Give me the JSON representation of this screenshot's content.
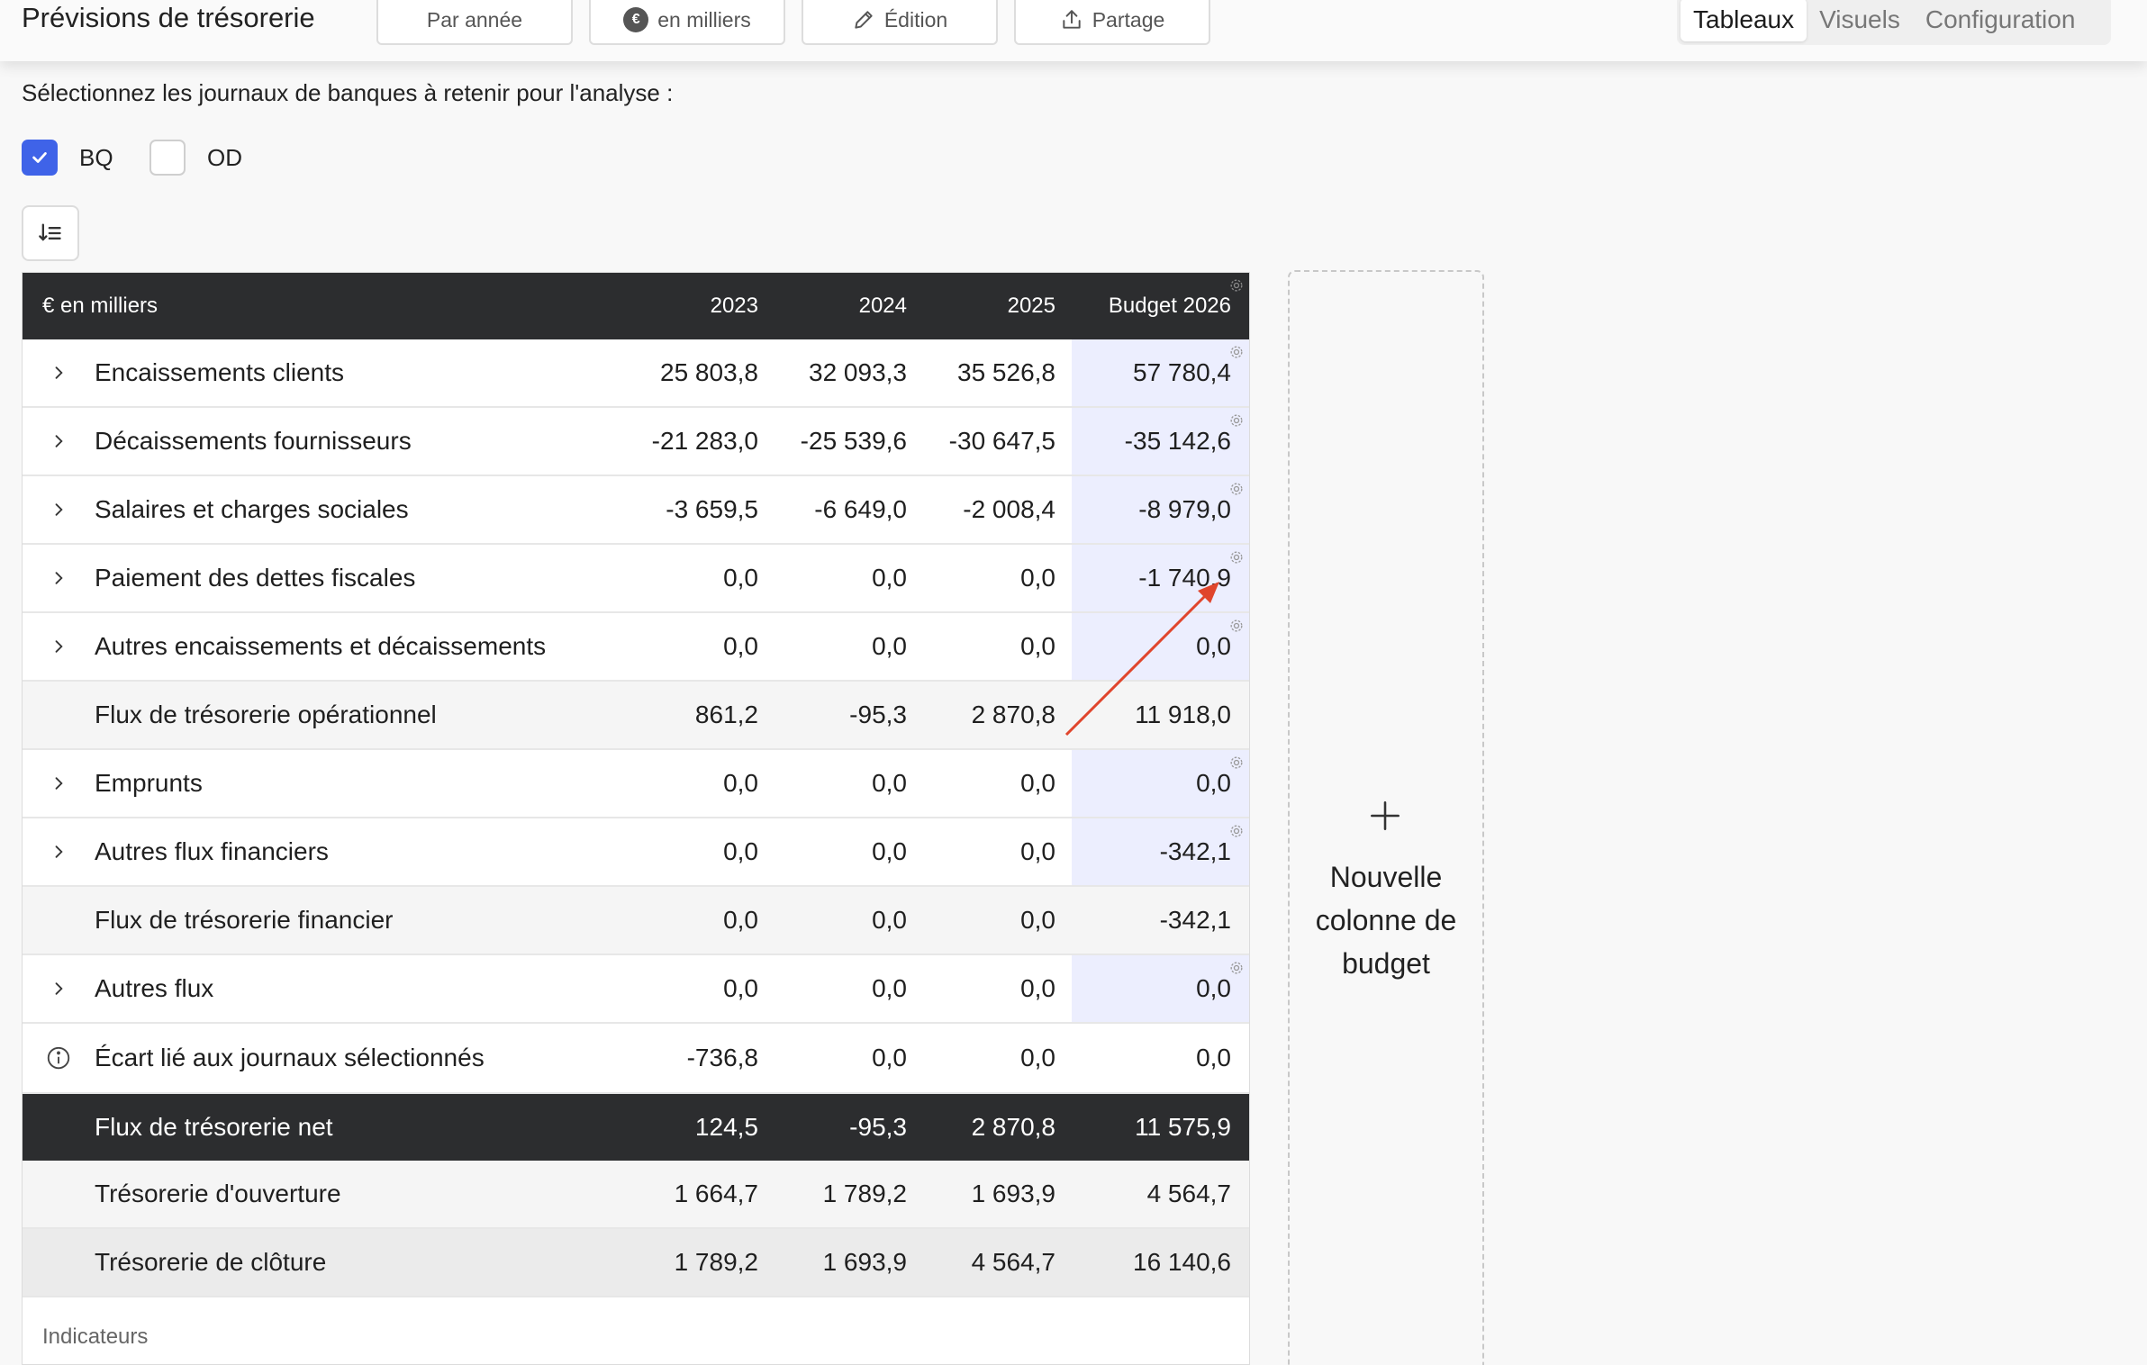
{
  "header": {
    "title": "Prévisions de trésorerie",
    "buttons": {
      "par_annee": "Par année",
      "en_milliers": "en milliers",
      "edition": "Édition",
      "partage": "Partage"
    },
    "euro_badge": "€",
    "view_tabs": [
      "Tableaux",
      "Visuels",
      "Configuration"
    ],
    "active_tab": "Tableaux"
  },
  "journals": {
    "label": "Sélectionnez les journaux de banques à retenir pour l'analyse :",
    "items": [
      {
        "label": "BQ",
        "checked": true
      },
      {
        "label": "OD",
        "checked": false
      }
    ]
  },
  "table": {
    "header": {
      "label": "€ en milliers",
      "cols": [
        "2023",
        "2024",
        "2025",
        "Budget 2026"
      ]
    },
    "rows": [
      {
        "label": "Encaissements clients",
        "values": [
          "25 803,8",
          "32 093,3",
          "35 526,8",
          "57 780,4"
        ]
      },
      {
        "label": "Décaissements fournisseurs",
        "values": [
          "-21 283,0",
          "-25 539,6",
          "-30 647,5",
          "-35 142,6"
        ]
      },
      {
        "label": "Salaires et charges sociales",
        "values": [
          "-3 659,5",
          "-6 649,0",
          "-2 008,4",
          "-8 979,0"
        ]
      },
      {
        "label": "Paiement des dettes fiscales",
        "values": [
          "0,0",
          "0,0",
          "0,0",
          "-1 740,9"
        ]
      },
      {
        "label": "Autres encaissements et décaissements",
        "values": [
          "0,0",
          "0,0",
          "0,0",
          "0,0"
        ]
      },
      {
        "label": "Flux de trésorerie opérationnel",
        "values": [
          "861,2",
          "-95,3",
          "2 870,8",
          "11 918,0"
        ]
      },
      {
        "label": "Emprunts",
        "values": [
          "0,0",
          "0,0",
          "0,0",
          "0,0"
        ]
      },
      {
        "label": "Autres flux financiers",
        "values": [
          "0,0",
          "0,0",
          "0,0",
          "-342,1"
        ]
      },
      {
        "label": "Flux de trésorerie financier",
        "values": [
          "0,0",
          "0,0",
          "0,0",
          "-342,1"
        ]
      },
      {
        "label": "Autres flux",
        "values": [
          "0,0",
          "0,0",
          "0,0",
          "0,0"
        ]
      },
      {
        "label": "Écart lié aux journaux sélectionnés",
        "values": [
          "-736,8",
          "0,0",
          "0,0",
          "0,0"
        ]
      },
      {
        "label": "Flux de trésorerie net",
        "values": [
          "124,5",
          "-95,3",
          "2 870,8",
          "11 575,9"
        ]
      },
      {
        "label": "Trésorerie d'ouverture",
        "values": [
          "1 664,7",
          "1 789,2",
          "1 693,9",
          "4 564,7"
        ]
      },
      {
        "label": "Trésorerie de clôture",
        "values": [
          "1 789,2",
          "1 693,9",
          "4 564,7",
          "16 140,6"
        ]
      }
    ],
    "indicators_label": "Indicateurs"
  },
  "new_column": {
    "label": "Nouvelle colonne de budget"
  },
  "colors": {
    "accent": "#3f63e8",
    "dark_row": "#2c2d2f",
    "budget_tint": "#eceefe",
    "annotation_arrow": "#e0452c"
  }
}
